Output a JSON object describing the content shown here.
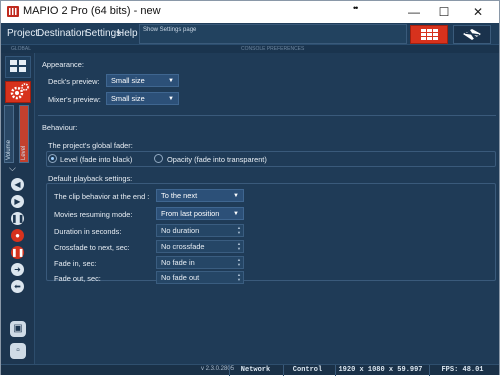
{
  "window": {
    "title": "MAPIO 2 Pro (64 bits) - new",
    "dots": "••",
    "minimize": "—",
    "maximize": "☐",
    "close": "✕"
  },
  "menu": {
    "items": [
      "Project",
      "Destination",
      "Settings",
      "Help"
    ],
    "tooltip": "Show Settings page",
    "subheader_left": "GLOBAL",
    "subheader_center": "CONSOLE PREFERENCES"
  },
  "sidebar": {
    "volume_tab": "Volume",
    "level_tab": "Level"
  },
  "appearance": {
    "heading": "Appearance:",
    "deck_label": "Deck's preview:",
    "deck_value": "Small size",
    "mixer_label": "Mixer's preview:",
    "mixer_value": "Small size"
  },
  "behaviour": {
    "heading": "Behaviour:",
    "fader_heading": "The project's global fader:",
    "fader_option1": "Level (fade into black)",
    "fader_option2": "Opacity (fade into transparent)",
    "fader_selected": "Level (fade into black)",
    "playback_heading": "Default playback settings:",
    "clip_label": "The clip behavior at the end :",
    "clip_value": "To the next",
    "resume_label": "Movies resuming mode:",
    "resume_value": "From last position",
    "duration_label": "Duration in seconds:",
    "duration_value": "No duration",
    "crossfade_label": "Crossfade to next, sec:",
    "crossfade_value": "No crossfade",
    "fadein_label": "Fade in, sec:",
    "fadein_value": "No fade in",
    "fadeout_label": "Fade out, sec:",
    "fadeout_value": "No fade out"
  },
  "status": {
    "version": "v 2.3.0.2805",
    "network": "Network",
    "control": "Control",
    "resolution": "1920 x 1080 x 59.997",
    "fps": "FPS: 48.01"
  },
  "colors": {
    "accent": "#d7321d",
    "background": "#1f3b57"
  }
}
